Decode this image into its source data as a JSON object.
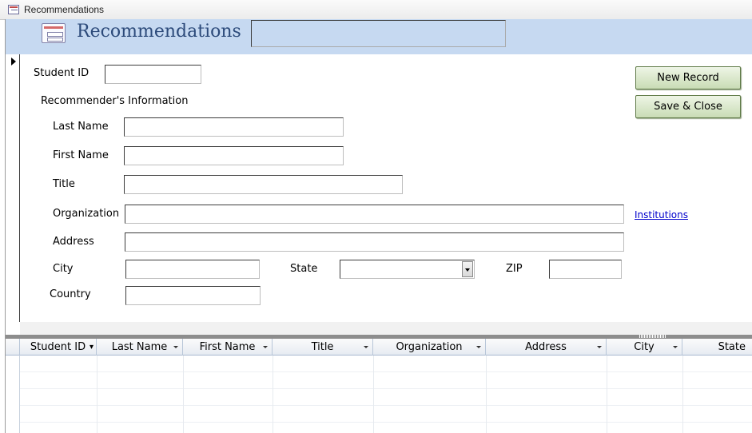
{
  "window": {
    "tab_title": "Recommendations"
  },
  "header": {
    "title": "Recommendations",
    "header_box_value": ""
  },
  "form": {
    "student_id_label": "Student ID",
    "section_label": "Recommender's Information",
    "last_name_label": "Last Name",
    "first_name_label": "First Name",
    "title_label": "Title",
    "organization_label": "Organization",
    "address_label": "Address",
    "city_label": "City",
    "state_label": "State",
    "zip_label": "ZIP",
    "country_label": "Country",
    "institutions_link": "Institutions",
    "values": {
      "student_id": "",
      "last_name": "",
      "first_name": "",
      "title": "",
      "organization": "",
      "address": "",
      "city": "",
      "state": "",
      "zip": "",
      "country": ""
    }
  },
  "buttons": {
    "new_record": "New Record",
    "save_close": "Save & Close"
  },
  "datasheet": {
    "columns": [
      "Student ID",
      "Last Name",
      "First Name",
      "Title",
      "Organization",
      "Address",
      "City",
      "State"
    ]
  },
  "colors": {
    "header_bg": "#c6d9f1",
    "button_bg": "#c9dcb5",
    "title_color": "#2c4a7a",
    "link_color": "#0000cc"
  }
}
